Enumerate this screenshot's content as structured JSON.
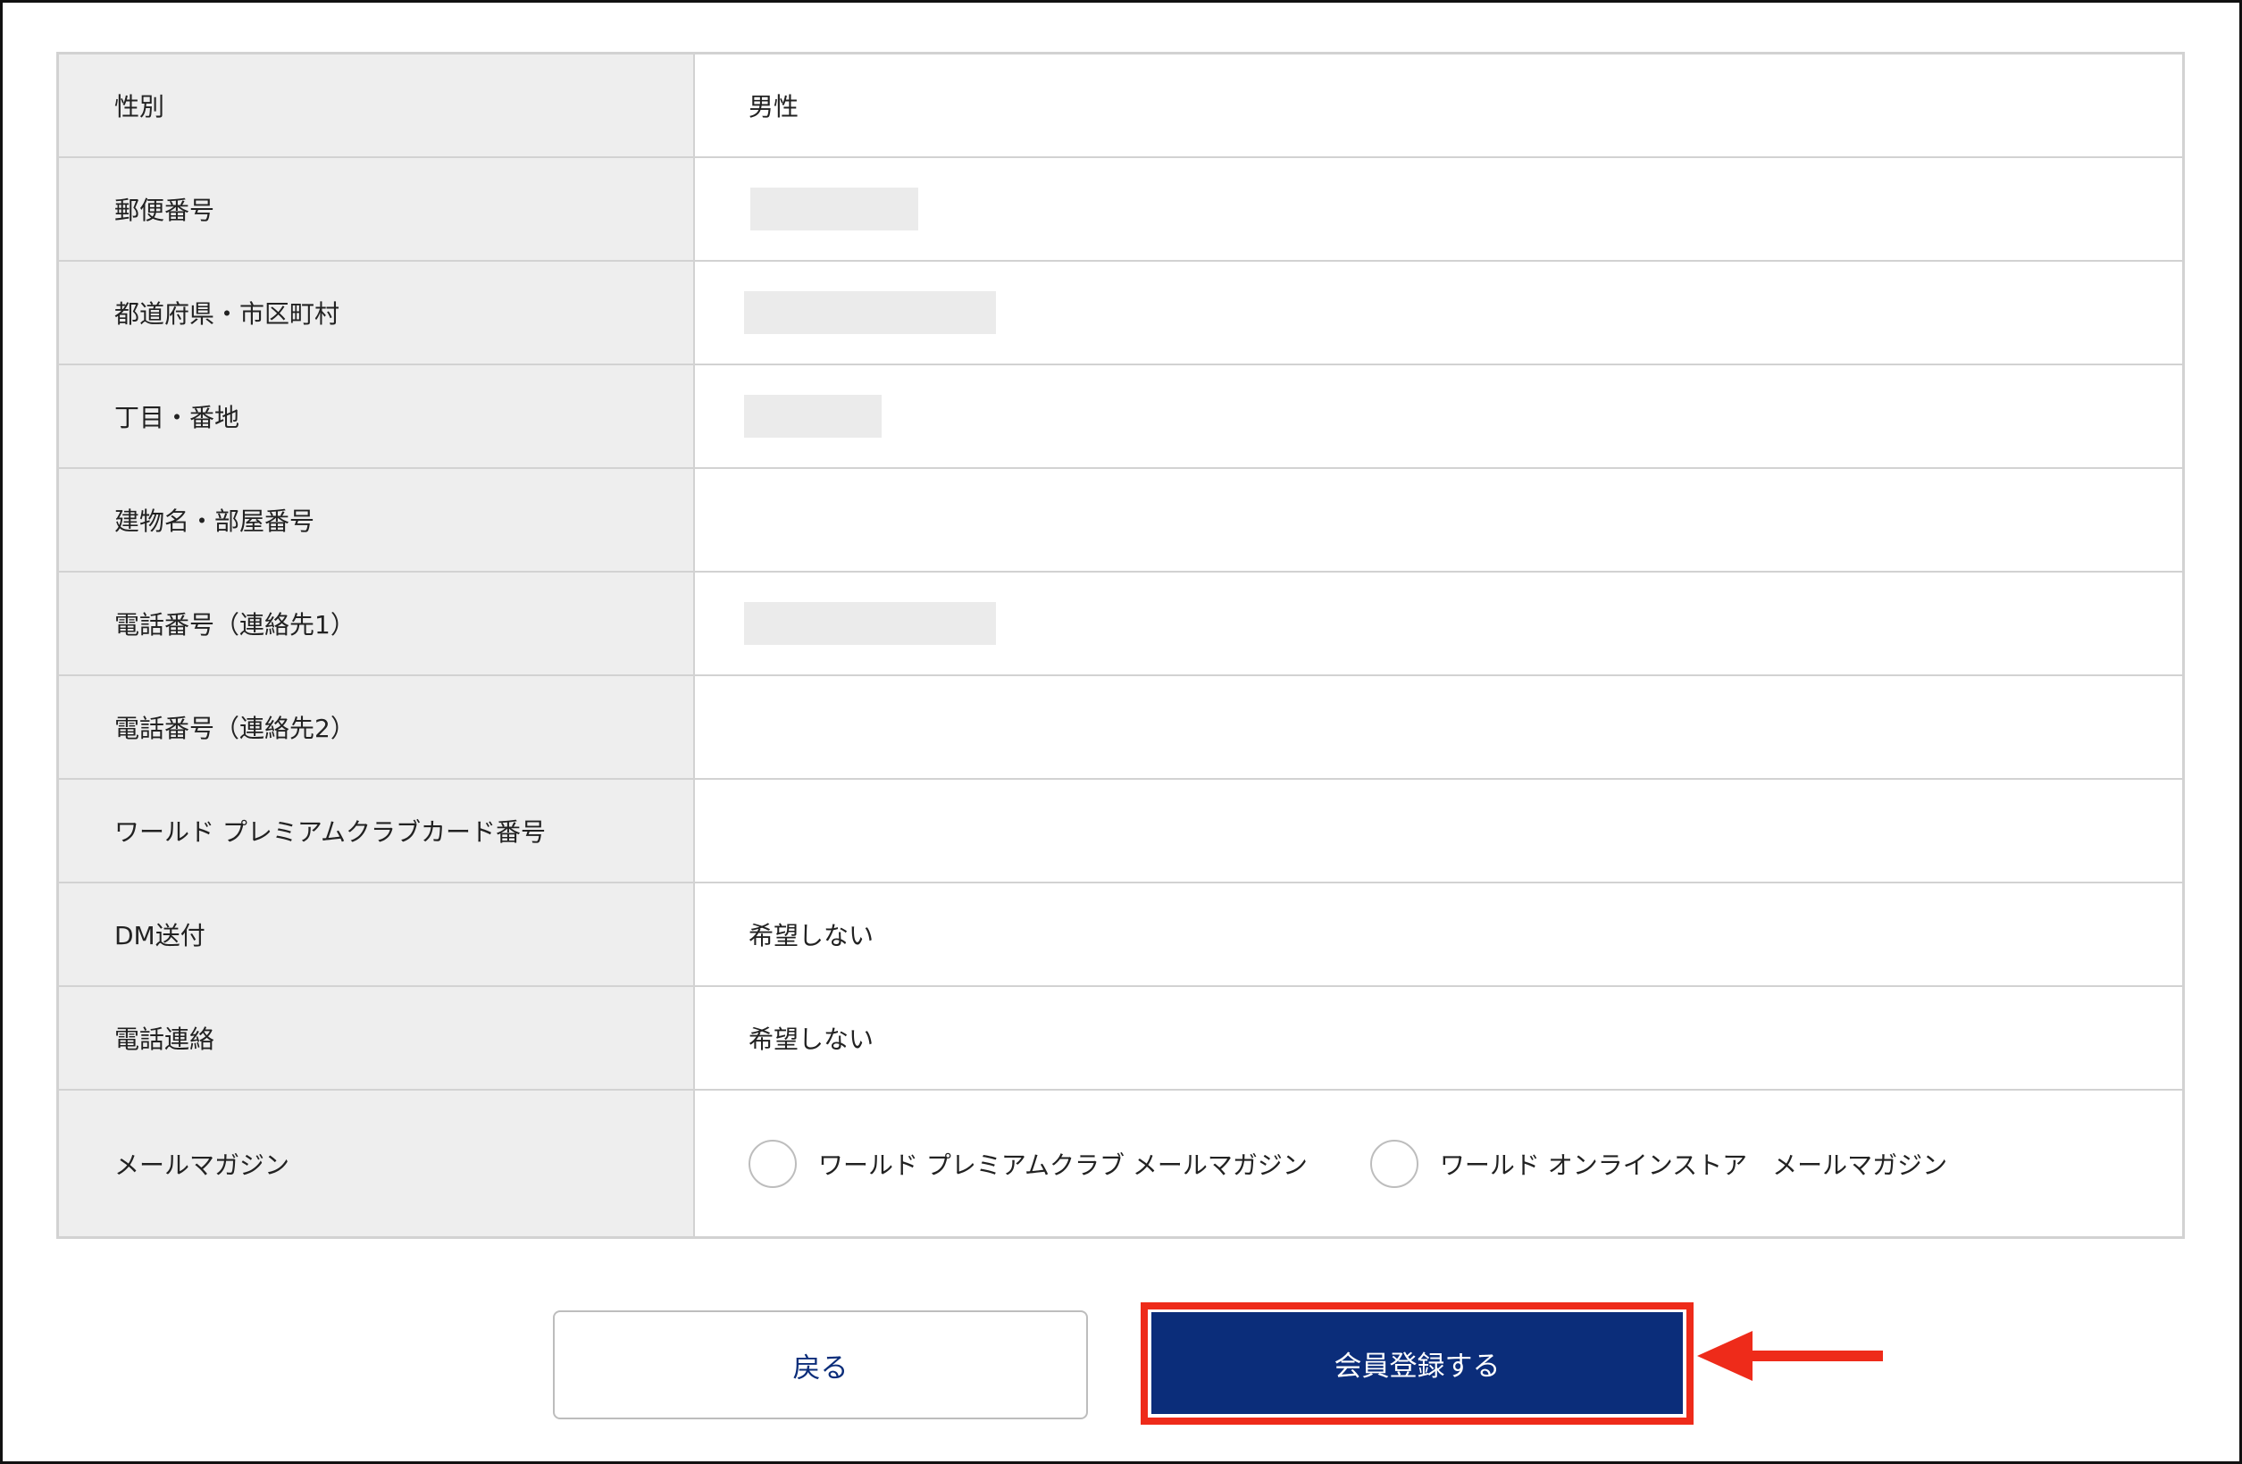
{
  "form": {
    "rows": [
      {
        "label": "性別",
        "value": "男性"
      },
      {
        "label": "郵便番号",
        "value": ""
      },
      {
        "label": "都道府県・市区町村",
        "value": ""
      },
      {
        "label": "丁目・番地",
        "value": ""
      },
      {
        "label": "建物名・部屋番号",
        "value": ""
      },
      {
        "label": "電話番号（連絡先1）",
        "value": ""
      },
      {
        "label": "電話番号（連絡先2）",
        "value": ""
      },
      {
        "label": "ワールド プレミアムクラブカード番号",
        "value": ""
      },
      {
        "label": "DM送付",
        "value": "希望しない"
      },
      {
        "label": "電話連絡",
        "value": "希望しない"
      },
      {
        "label": "メールマガジン",
        "value": ""
      }
    ],
    "newsletter_options": [
      {
        "label": "ワールド プレミアムクラブ メールマガジン",
        "checked": false
      },
      {
        "label": "ワールド オンラインストア　メールマガジン",
        "checked": false
      }
    ]
  },
  "actions": {
    "back_label": "戻る",
    "register_label": "会員登録する"
  },
  "colors": {
    "primary": "#0b2d7a",
    "highlight": "#ee2b1a",
    "label_bg": "#eeeeee",
    "border": "#d2d2d2"
  },
  "icons": {
    "pointer": "arrow-left-icon"
  }
}
